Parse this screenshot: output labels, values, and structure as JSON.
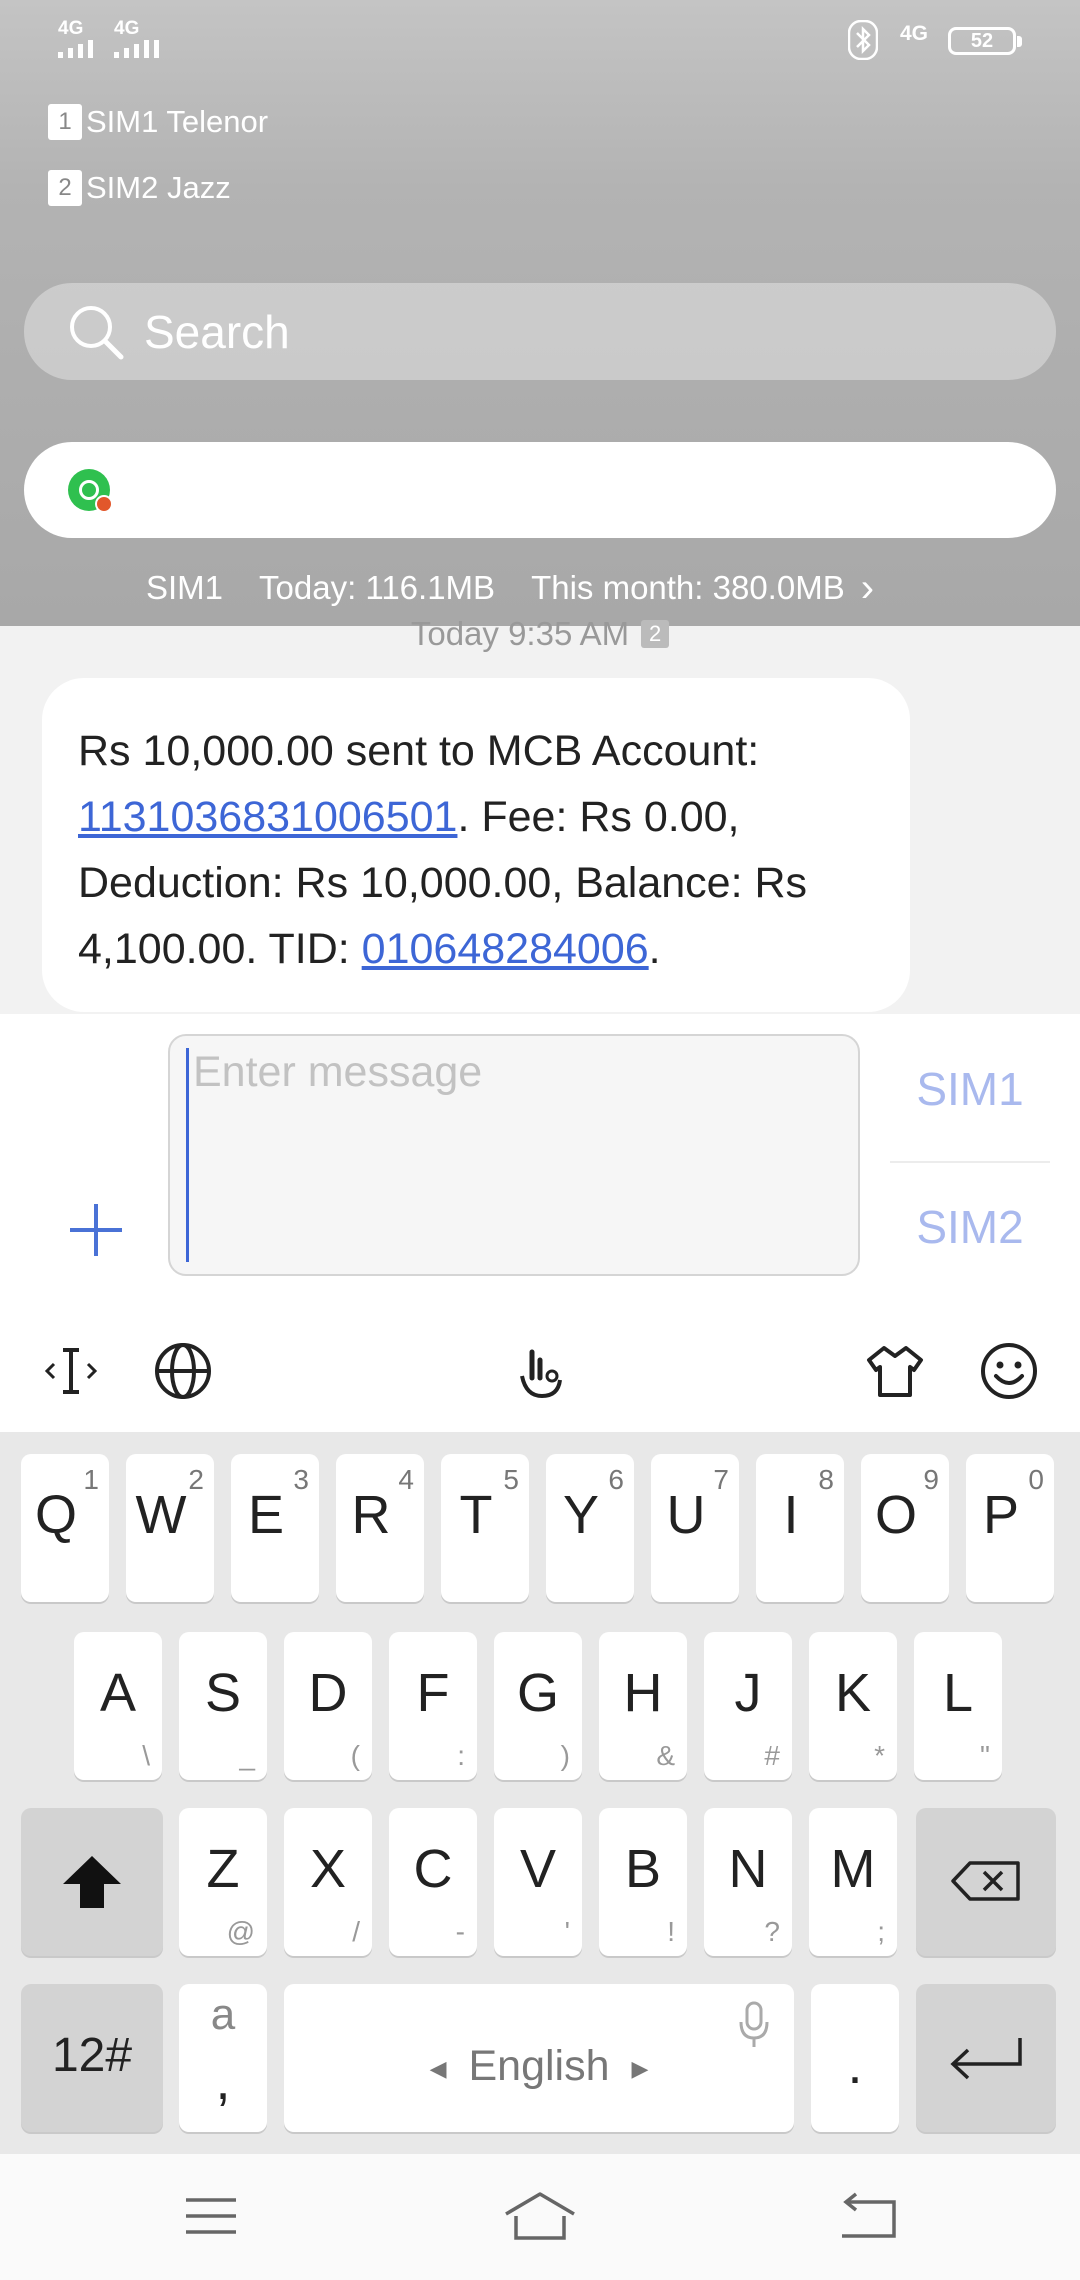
{
  "status_bar": {
    "signal1_label": "4G",
    "signal2_label": "4G",
    "network_label": "4G",
    "battery_level": "52"
  },
  "shade": {
    "sims": [
      {
        "num": "1",
        "name": "SIM1 Telenor"
      },
      {
        "num": "2",
        "name": "SIM2 Jazz"
      }
    ],
    "search_placeholder": "Search",
    "notification_app_icon": "whatsapp-icon",
    "data_usage": {
      "sim": "SIM1",
      "today": "Today: 116.1MB",
      "month": "This month: 380.0MB",
      "chevron": "›"
    }
  },
  "conversation": {
    "timestamp": "Today 9:35 AM",
    "timestamp_sim": "2",
    "message": {
      "text1": "Rs 10,000.00 sent to MCB Account: ",
      "link1": "1131036831006501",
      "text2": ". Fee: Rs 0.00, Deduction: Rs 10,000.00, Balance: Rs 4,100.00. TID: ",
      "link2": "010648284006",
      "text3": "."
    }
  },
  "compose": {
    "placeholder": "Enter message",
    "sim1": "SIM1",
    "sim2": "SIM2"
  },
  "keyboard": {
    "toolbar_icons": [
      "cursor-icon",
      "globe-icon",
      "gesture-icon",
      "theme-shirt-icon",
      "emoji-icon"
    ],
    "row1": [
      {
        "k": "Q",
        "s": "1"
      },
      {
        "k": "W",
        "s": "2"
      },
      {
        "k": "E",
        "s": "3"
      },
      {
        "k": "R",
        "s": "4"
      },
      {
        "k": "T",
        "s": "5"
      },
      {
        "k": "Y",
        "s": "6"
      },
      {
        "k": "U",
        "s": "7"
      },
      {
        "k": "I",
        "s": "8"
      },
      {
        "k": "O",
        "s": "9"
      },
      {
        "k": "P",
        "s": "0"
      }
    ],
    "row2": [
      {
        "k": "A",
        "s": "\\"
      },
      {
        "k": "S",
        "s": "_"
      },
      {
        "k": "D",
        "s": "("
      },
      {
        "k": "F",
        "s": ":"
      },
      {
        "k": "G",
        "s": ")"
      },
      {
        "k": "H",
        "s": "&"
      },
      {
        "k": "J",
        "s": "#"
      },
      {
        "k": "K",
        "s": "*"
      },
      {
        "k": "L",
        "s": "\""
      }
    ],
    "row3": [
      {
        "k": "Z",
        "s": "@"
      },
      {
        "k": "X",
        "s": "/"
      },
      {
        "k": "C",
        "s": "-"
      },
      {
        "k": "V",
        "s": "'"
      },
      {
        "k": "B",
        "s": "!"
      },
      {
        "k": "N",
        "s": "?"
      },
      {
        "k": "M",
        "s": ";"
      }
    ],
    "symbols_key": "12#",
    "comma_key_top": "a",
    "comma_key_bottom": ",",
    "space_label": "English",
    "space_left_arrow": "◀",
    "space_right_arrow": "▶",
    "period_key": "."
  },
  "colors": {
    "accent": "#3d66d6",
    "sim_button": "#a9b9ee",
    "shade_bg": "#b3b3b3"
  }
}
